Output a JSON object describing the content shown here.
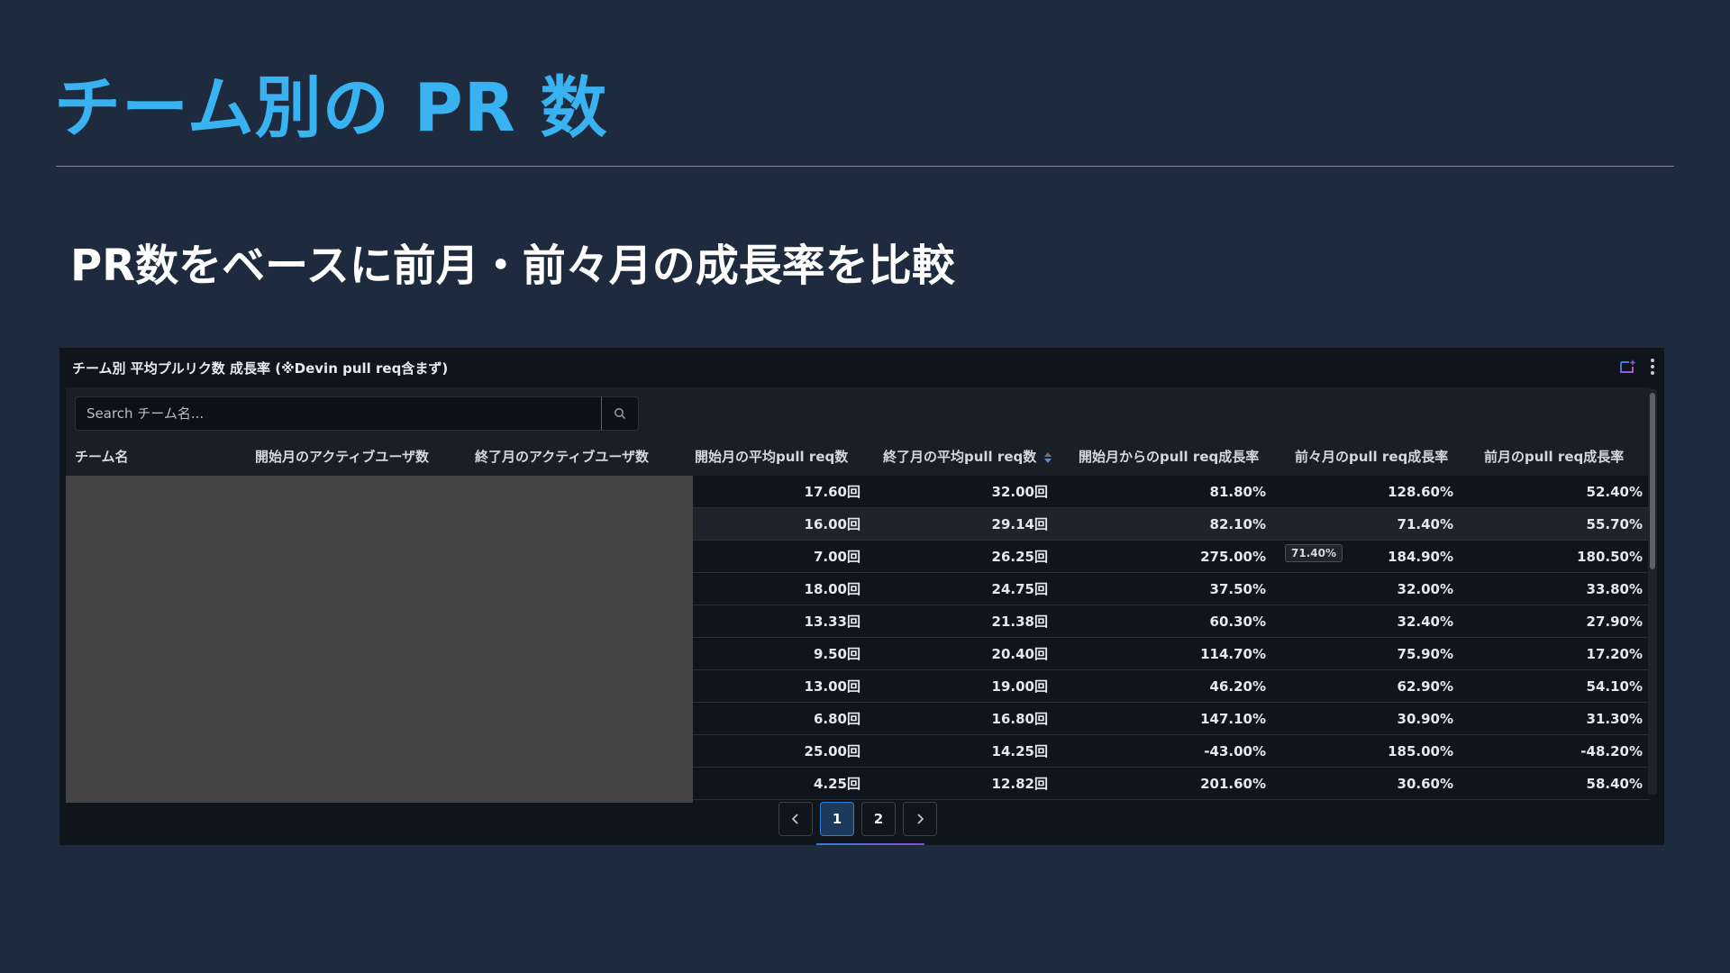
{
  "slide": {
    "title": "チーム別の PR 数",
    "subtitle": "PR数をベースに前月・前々月の成長率を比較"
  },
  "panel": {
    "title": "チーム別 平均プルリク数 成長率 (※Devin pull req含まず)",
    "search_placeholder": "Search チーム名..."
  },
  "table": {
    "headers": [
      "チーム名",
      "開始月のアクティブユーザ数",
      "終了月のアクティブユーザ数",
      "開始月の平均pull req数",
      "終了月の平均pull req数",
      "開始月からのpull req成長率",
      "前々月のpull req成長率",
      "前月のpull req成長率"
    ],
    "rows": [
      [
        "17.60回",
        "32.00回",
        "81.80%",
        "128.60%",
        "52.40%"
      ],
      [
        "16.00回",
        "29.14回",
        "82.10%",
        "71.40%",
        "55.70%"
      ],
      [
        "7.00回",
        "26.25回",
        "275.00%",
        "184.90%",
        "180.50%"
      ],
      [
        "18.00回",
        "24.75回",
        "37.50%",
        "32.00%",
        "33.80%"
      ],
      [
        "13.33回",
        "21.38回",
        "60.30%",
        "32.40%",
        "27.90%"
      ],
      [
        "9.50回",
        "20.40回",
        "114.70%",
        "75.90%",
        "17.20%"
      ],
      [
        "13.00回",
        "19.00回",
        "46.20%",
        "62.90%",
        "54.10%"
      ],
      [
        "6.80回",
        "16.80回",
        "147.10%",
        "30.90%",
        "31.30%"
      ],
      [
        "25.00回",
        "14.25回",
        "-43.00%",
        "185.00%",
        "-48.20%"
      ],
      [
        "4.25回",
        "12.82回",
        "201.60%",
        "30.60%",
        "58.40%"
      ]
    ],
    "hover_row_index": 1,
    "tooltip": "71.40%"
  },
  "pagination": {
    "pages": [
      "1",
      "2"
    ],
    "current": "1"
  }
}
